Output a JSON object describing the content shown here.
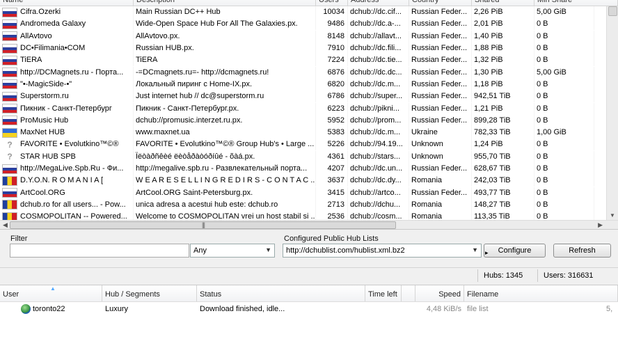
{
  "hub_table": {
    "columns": [
      "Name",
      "Description",
      "Users",
      "Address",
      "Country",
      "Shared",
      "Min Share"
    ],
    "rows": [
      {
        "flag": "ru",
        "name": "Cifra.Ozerki",
        "desc": "Main Russian DC++ Hub",
        "users": "10034",
        "addr": "dchub://dc.cif...",
        "country": "Russian Feder...",
        "shared": "2,26 PiB",
        "min_share": "5,00 GiB"
      },
      {
        "flag": "ru",
        "name": "Andromeda Galaxy",
        "desc": "Wide-Open Space Hub For All The Galaxies.px.",
        "users": "9486",
        "addr": "dchub://dc.a-...",
        "country": "Russian Feder...",
        "shared": "2,01 PiB",
        "min_share": "0 B"
      },
      {
        "flag": "ru",
        "name": "AllAvtovo",
        "desc": "AllAvtovo.px.",
        "users": "8148",
        "addr": "dchub://allavt...",
        "country": "Russian Feder...",
        "shared": "1,40 PiB",
        "min_share": "0 B"
      },
      {
        "flag": "ru",
        "name": "DC•Filimania•COM",
        "desc": "Russian HUB.px.",
        "users": "7910",
        "addr": "dchub://dc.fili...",
        "country": "Russian Feder...",
        "shared": "1,88 PiB",
        "min_share": "0 B"
      },
      {
        "flag": "ru",
        "name": "TiERA",
        "desc": "TiERA",
        "users": "7224",
        "addr": "dchub://dc.tie...",
        "country": "Russian Feder...",
        "shared": "1,32 PiB",
        "min_share": "0 B"
      },
      {
        "flag": "ru",
        "name": "http://DCMagnets.ru - Порта...",
        "desc": "-=DCmagnets.ru=- http://dcmagnets.ru!",
        "users": "6876",
        "addr": "dchub://dc.dc...",
        "country": "Russian Feder...",
        "shared": "1,30 PiB",
        "min_share": "5,00 GiB"
      },
      {
        "flag": "ru",
        "name": "\"•-MagicSide-•\"",
        "desc": "Локальный пиринг с Home-IX.px.",
        "users": "6820",
        "addr": "dchub://dc.m...",
        "country": "Russian Feder...",
        "shared": "1,18 PiB",
        "min_share": "0 B"
      },
      {
        "flag": "ru",
        "name": "Superstorm.ru",
        "desc": "Just internet hub // dc@superstorm.ru",
        "users": "6786",
        "addr": "dchub://super...",
        "country": "Russian Feder...",
        "shared": "942,51 TiB",
        "min_share": "0 B"
      },
      {
        "flag": "ru",
        "name": "Пикник - Санкт-Петербург",
        "desc": "Пикник - Санкт-Петербург.px.",
        "users": "6223",
        "addr": "dchub://pikni...",
        "country": "Russian Feder...",
        "shared": "1,21 PiB",
        "min_share": "0 B"
      },
      {
        "flag": "ru",
        "name": "ProMusic Hub",
        "desc": "dchub://promusic.interzet.ru.px.",
        "users": "5952",
        "addr": "dchub://prom...",
        "country": "Russian Feder...",
        "shared": "899,28 TiB",
        "min_share": "0 B"
      },
      {
        "flag": "ua",
        "name": "MaxNet HUB",
        "desc": "www.maxnet.ua",
        "users": "5383",
        "addr": "dchub://dc.m...",
        "country": "Ukraine",
        "shared": "782,33 TiB",
        "min_share": "1,00 GiB"
      },
      {
        "flag": "un",
        "name": "FAVORITE • Evolutkino™©®",
        "desc": "FAVORITE • Evolutkino™©® Group Hub's • Large ...",
        "users": "5226",
        "addr": "dchub://94.19...",
        "country": "Unknown",
        "shared": "1,24 PiB",
        "min_share": "0 B"
      },
      {
        "flag": "un",
        "name": "STAR HUB SPB",
        "desc": "Ïëòàðñêèé ëèòåðàòóðíûé - õàá.px.",
        "users": "4361",
        "addr": "dchub://stars...",
        "country": "Unknown",
        "shared": "955,70 TiB",
        "min_share": "0 B"
      },
      {
        "flag": "ru",
        "name": "http://MegaLive.Spb.Ru - Фи...",
        "desc": "http://megalive.spb.ru - Развлекательный порта...",
        "users": "4207",
        "addr": "dchub://dc.un...",
        "country": "Russian Feder...",
        "shared": "628,67 TiB",
        "min_share": "0 B"
      },
      {
        "flag": "ro",
        "name": "D.Y.O.N.  R O M A N I A     [",
        "desc": "W E  A R E  S E L L I N G  R E D I R S  -  C O N T A C ...",
        "users": "3637",
        "addr": "dchub://dc.dy...",
        "country": "Romania",
        "shared": "242,03 TiB",
        "min_share": "0 B"
      },
      {
        "flag": "ru",
        "name": "ArtCool.ORG",
        "desc": "ArtCool.ORG Saint-Petersburg.px.",
        "users": "3415",
        "addr": "dchub://artco...",
        "country": "Russian Feder...",
        "shared": "493,77 TiB",
        "min_share": "0 B"
      },
      {
        "flag": "ro",
        "name": "dchub.ro for all users... - Pow...",
        "desc": "unica adresa a acestui hub este:  dchub.ro",
        "users": "2713",
        "addr": "dchub://dchu...",
        "country": "Romania",
        "shared": "148,27 TiB",
        "min_share": "0 B"
      },
      {
        "flag": "ro",
        "name": "COSMOPOLITAN -- Powered...",
        "desc": "Welcome to COSMOPOLITAN vrei un host stabil si ...",
        "users": "2536",
        "addr": "dchub://cosm...",
        "country": "Romania",
        "shared": "113,35 TiB",
        "min_share": "0 B"
      }
    ]
  },
  "filter": {
    "label": "Filter",
    "value": "",
    "field_select": "Any"
  },
  "config": {
    "label": "Configured Public Hub Lists",
    "hublist_url": "http://dchublist.com/hublist.xml.bz2",
    "configure_label": "Configure",
    "refresh_label": "Refresh"
  },
  "status": {
    "hubs": "Hubs: 1345",
    "users": "Users: 316631"
  },
  "transfers": {
    "columns": [
      "User",
      "Hub / Segments",
      "Status",
      "Time left",
      "Speed",
      "Filename"
    ],
    "rows": [
      {
        "user": "toronto22",
        "hub": "Luxury",
        "status": "Download finished, idle...",
        "time_left": "",
        "speed": "4,48 KiB/s",
        "filename": "file list",
        "extra": "5,"
      }
    ]
  }
}
